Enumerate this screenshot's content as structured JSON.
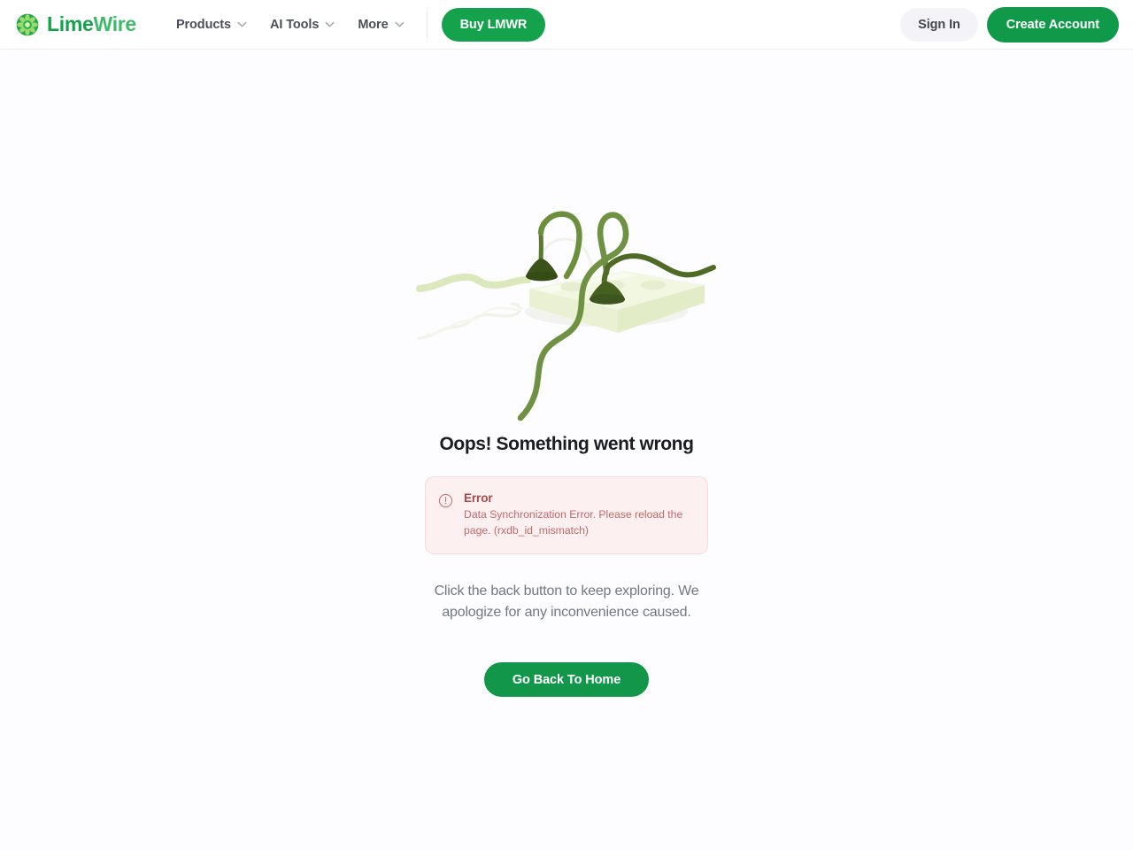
{
  "header": {
    "brand": {
      "icon": "limewire-flower-logo-icon",
      "name_part1": "Lime",
      "name_part2": "Wire"
    },
    "nav_items": [
      {
        "label": "Products",
        "icon": "chevron-down-icon"
      },
      {
        "label": "AI Tools",
        "icon": "chevron-down-icon"
      },
      {
        "label": "More",
        "icon": "chevron-down-icon"
      }
    ],
    "buy_button": "Buy LMWR",
    "sign_in_button": "Sign In",
    "create_account_button": "Create Account"
  },
  "main": {
    "illustration_name": "unplugged-power-strip-illustration",
    "title": "Oops! Something went wrong",
    "error": {
      "icon": "exclamation-circle-icon",
      "title": "Error",
      "description": "Data Synchronization Error. Please reload the page. (rxdb_id_mismatch)"
    },
    "apology": "Click the back button to keep exploring. We apologize for any inconvenience caused.",
    "home_button": "Go Back To Home"
  },
  "colors": {
    "brand_green_dark": "#13a24a",
    "brand_green_light": "#3fba6b",
    "button_green": "#11964a",
    "page_background": "#fdfcff",
    "error_background": "#fdf0f0",
    "error_border": "#f6dcdc",
    "error_title_text": "#a8484a",
    "error_body_text": "#c4696a",
    "illustration_dark_green": "#3f5520",
    "illustration_mid_green": "#6e9242",
    "illustration_pale_green": "#eef4dd"
  }
}
